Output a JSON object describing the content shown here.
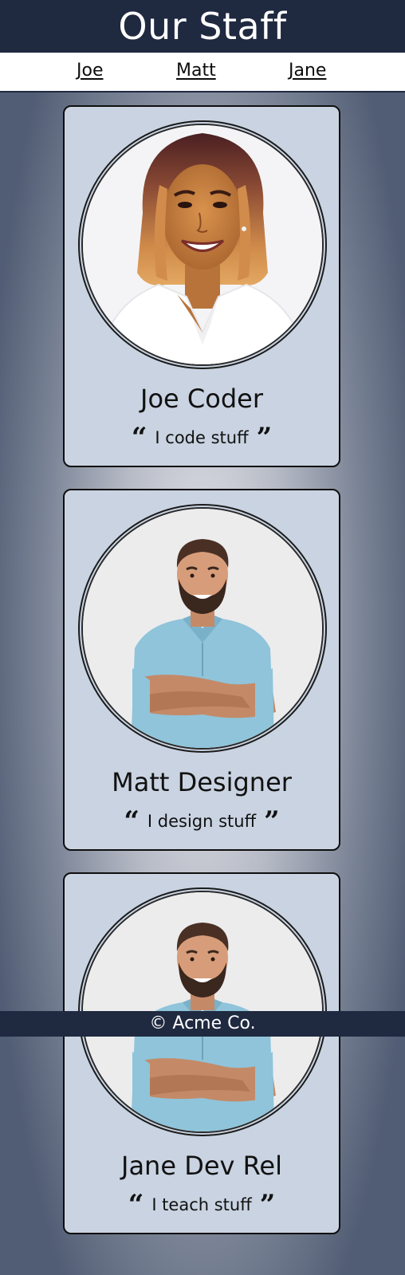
{
  "header": {
    "title": "Our Staff"
  },
  "nav": {
    "items": [
      "Joe",
      "Matt",
      "Jane"
    ]
  },
  "staff": [
    {
      "name": "Joe Coder",
      "quote": "I code stuff",
      "photo_icon": "woman-portrait-icon"
    },
    {
      "name": "Matt Designer",
      "quote": "I design stuff",
      "photo_icon": "man-portrait-icon"
    },
    {
      "name": "Jane Dev Rel",
      "quote": "I teach stuff",
      "photo_icon": "man-portrait-icon"
    }
  ],
  "quote_marks": {
    "open": "“",
    "close": "”"
  },
  "footer": {
    "text": "© Acme Co."
  },
  "colors": {
    "header_bg": "#1f2940",
    "card_bg": "#c9d3e1",
    "page_gradient_center": "#e4e5ea",
    "page_gradient_edge": "#515d74",
    "matt_shirt": "#8fc4da",
    "joe_jacket": "#ffffff"
  }
}
